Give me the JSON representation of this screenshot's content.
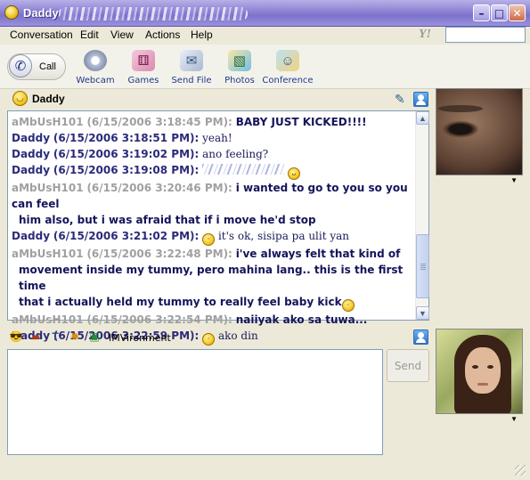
{
  "window": {
    "title": "Daddy"
  },
  "menu": [
    "Conversation",
    "Edit",
    "View",
    "Actions",
    "Help"
  ],
  "toolbar": {
    "call": "Call",
    "tools": [
      "Webcam",
      "Games",
      "Send File",
      "Photos",
      "Conference"
    ]
  },
  "contact": {
    "name": "Daddy"
  },
  "messages": [
    {
      "sender": "aMbUsH101",
      "time": "(6/15/2006 3:18:45 PM):",
      "text": "BABY JUST KICKED!!!!",
      "cont": ""
    },
    {
      "sender": "Daddy",
      "time": "(6/15/2006 3:18:51 PM):",
      "text": "yeah!",
      "cont": ""
    },
    {
      "sender": "Daddy",
      "time": "(6/15/2006 3:19:02 PM):",
      "text": "ano feeling?",
      "cont": ""
    },
    {
      "sender": "Daddy",
      "time": "(6/15/2006 3:19:08 PM):",
      "text": "",
      "cont": ""
    },
    {
      "sender": "aMbUsH101",
      "time": "(6/15/2006 3:20:46 PM):",
      "text": "i wanted to go to you so you can feel",
      "cont": "him also, but i was afraid that if i move he'd stop"
    },
    {
      "sender": "Daddy",
      "time": "(6/15/2006 3:21:02 PM):",
      "text": "it's ok, sisipa pa ulit yan",
      "cont": ""
    },
    {
      "sender": "aMbUsH101",
      "time": "(6/15/2006 3:22:48 PM):",
      "text": "i've always felt that kind of",
      "cont": "movement inside my tummy, pero mahina lang.. this is the first time",
      "cont2": "that i actually held my tummy to really feel baby kick"
    },
    {
      "sender": "aMbUsH101",
      "time": "(6/15/2006 3:22:54 PM):",
      "text": "naiiyak ako sa tuwa...",
      "cont": ""
    },
    {
      "sender": "Daddy",
      "time": "(6/15/2006 3:22:59 PM):",
      "text": "ako din",
      "cont": ""
    }
  ],
  "input": {
    "imvironment": "IMVironment",
    "send": "Send"
  },
  "colors": {
    "title_bar": "#8f86d6",
    "window_bg": "#ece9d8",
    "message_text": "#1a1a5c"
  }
}
